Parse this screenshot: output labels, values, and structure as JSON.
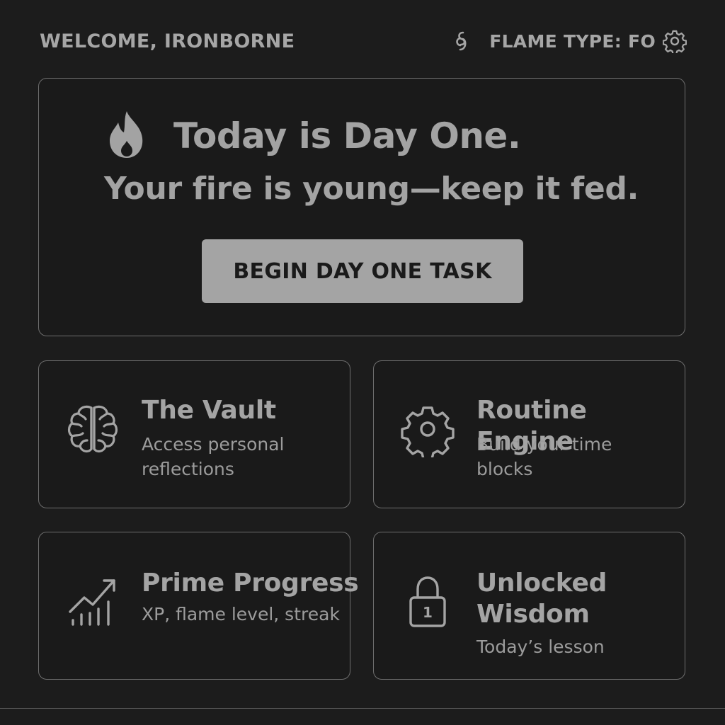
{
  "header": {
    "welcome": "WELCOME, IRONBORNE",
    "flame_type": "FLAME TYPE: FO",
    "link_icon": "link-icon",
    "settings_icon": "gear-icon"
  },
  "hero": {
    "icon": "flame-icon",
    "title": "Today is Day One.",
    "subtitle": "Your fire is young—keep it fed.",
    "button_label": "BEGIN DAY ONE TASK"
  },
  "cards": [
    {
      "icon": "brain-icon",
      "title": "The Vault",
      "description": "Access personal reflections"
    },
    {
      "icon": "gear-icon",
      "title": "Routine Engine",
      "description": "Build your time blocks"
    },
    {
      "icon": "chart-up-icon",
      "title": "Prime Progress",
      "description": "XP, flame level, streak"
    },
    {
      "icon": "lock-icon",
      "title": "Unlocked Wisdom",
      "description": "Today’s lesson",
      "lock_badge": "1"
    }
  ],
  "colors": {
    "background": "#1c1c1c",
    "border": "#6e6e6e",
    "text": "#a4a4a4",
    "button_bg": "#a4a4a4",
    "button_text": "#1a1a1a"
  }
}
